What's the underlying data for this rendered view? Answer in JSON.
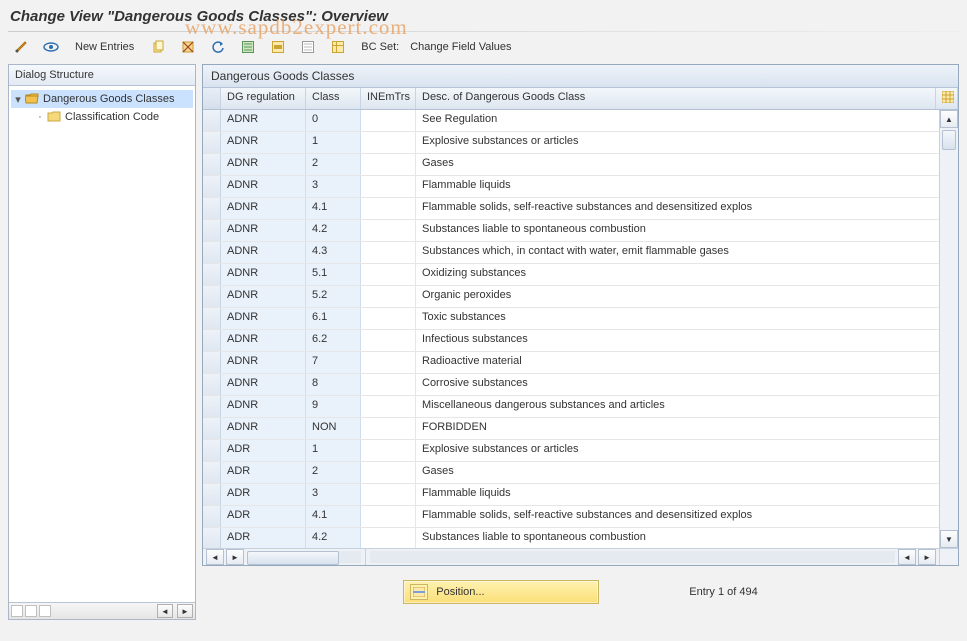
{
  "title": "Change View \"Dangerous Goods Classes\": Overview",
  "toolbar": {
    "new_entries": "New Entries",
    "bcset": "BC Set:",
    "change_field_values": "Change Field Values"
  },
  "tree": {
    "header": "Dialog Structure",
    "items": [
      {
        "label": "Dangerous Goods Classes"
      },
      {
        "label": "Classification Code"
      }
    ]
  },
  "grid": {
    "title": "Dangerous Goods Classes",
    "columns": {
      "reg": "DG regulation",
      "class": "Class",
      "inem": "INEmTrs",
      "desc": "Desc. of Dangerous Goods Class"
    },
    "rows": [
      {
        "reg": "ADNR",
        "class": "0",
        "inem": "",
        "desc": "See Regulation"
      },
      {
        "reg": "ADNR",
        "class": "1",
        "inem": "",
        "desc": "Explosive substances or articles"
      },
      {
        "reg": "ADNR",
        "class": "2",
        "inem": "",
        "desc": "Gases"
      },
      {
        "reg": "ADNR",
        "class": "3",
        "inem": "",
        "desc": "Flammable liquids"
      },
      {
        "reg": "ADNR",
        "class": "4.1",
        "inem": "",
        "desc": "Flammable solids, self-reactive substances and desensitized explos"
      },
      {
        "reg": "ADNR",
        "class": "4.2",
        "inem": "",
        "desc": "Substances liable to spontaneous combustion"
      },
      {
        "reg": "ADNR",
        "class": "4.3",
        "inem": "",
        "desc": "Substances which, in contact with water, emit flammable gases"
      },
      {
        "reg": "ADNR",
        "class": "5.1",
        "inem": "",
        "desc": "Oxidizing substances"
      },
      {
        "reg": "ADNR",
        "class": "5.2",
        "inem": "",
        "desc": "Organic peroxides"
      },
      {
        "reg": "ADNR",
        "class": "6.1",
        "inem": "",
        "desc": "Toxic substances"
      },
      {
        "reg": "ADNR",
        "class": "6.2",
        "inem": "",
        "desc": "Infectious substances"
      },
      {
        "reg": "ADNR",
        "class": "7",
        "inem": "",
        "desc": "Radioactive material"
      },
      {
        "reg": "ADNR",
        "class": "8",
        "inem": "",
        "desc": "Corrosive substances"
      },
      {
        "reg": "ADNR",
        "class": "9",
        "inem": "",
        "desc": "Miscellaneous dangerous substances and articles"
      },
      {
        "reg": "ADNR",
        "class": "NON",
        "inem": "",
        "desc": "FORBIDDEN"
      },
      {
        "reg": "ADR",
        "class": "1",
        "inem": "",
        "desc": "Explosive substances or articles"
      },
      {
        "reg": "ADR",
        "class": "2",
        "inem": "",
        "desc": "Gases"
      },
      {
        "reg": "ADR",
        "class": "3",
        "inem": "",
        "desc": "Flammable liquids"
      },
      {
        "reg": "ADR",
        "class": "4.1",
        "inem": "",
        "desc": "Flammable solids, self-reactive substances and desensitized explos"
      },
      {
        "reg": "ADR",
        "class": "4.2",
        "inem": "",
        "desc": "Substances liable to spontaneous combustion"
      }
    ]
  },
  "footer": {
    "position_label": "Position...",
    "entry_text": "Entry 1 of 494"
  },
  "watermark": "www.sapdb2expert.com"
}
